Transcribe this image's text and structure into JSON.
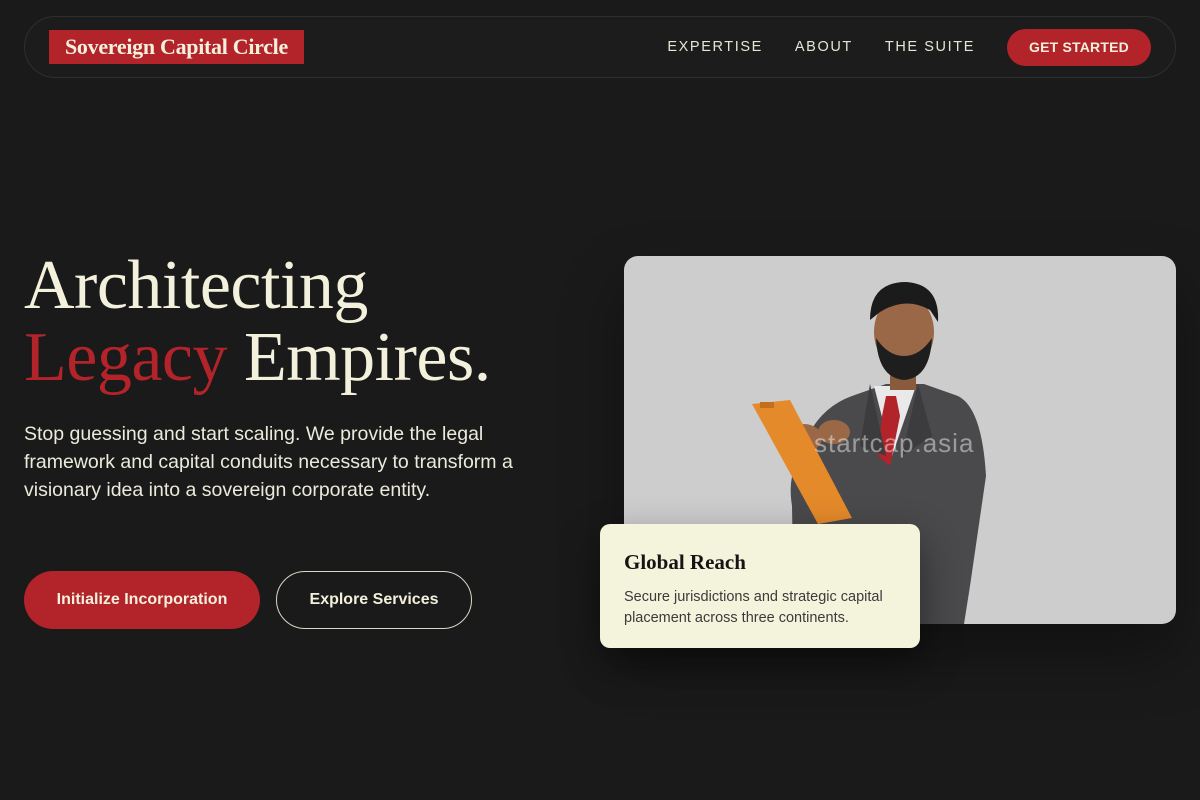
{
  "brand": {
    "name": "Sovereign Capital Circle"
  },
  "nav": {
    "items": [
      {
        "label": "EXPERTISE"
      },
      {
        "label": "ABOUT"
      },
      {
        "label": "THE SUITE"
      }
    ],
    "cta_label": "GET STARTED"
  },
  "hero": {
    "title_line1": "Architecting",
    "title_accent": "Legacy",
    "title_rest": " Empires.",
    "subtitle": "Stop guessing and start scaling. We provide the legal framework and capital conduits necessary to transform a visionary idea into a sovereign corporate entity.",
    "primary_button": "Initialize Incorporation",
    "secondary_button": "Explore Services"
  },
  "photo": {
    "watermark": "startcap.asia"
  },
  "info_card": {
    "title": "Global Reach",
    "text": "Secure jurisdictions and strategic capital placement across three continents."
  },
  "colors": {
    "background": "#1a1a1a",
    "accent": "#b3232a",
    "cream": "#f3f1dc"
  }
}
